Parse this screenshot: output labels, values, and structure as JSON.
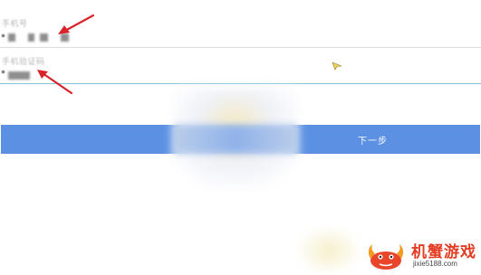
{
  "form": {
    "phone": {
      "label": "手机号",
      "value_masked": true
    },
    "code": {
      "label": "手机验证码",
      "value_masked": true
    }
  },
  "actions": {
    "next_label": "下一步"
  },
  "watermark": {
    "brand": "机蟹游戏",
    "url": "jixie5188.com"
  },
  "colors": {
    "button": "#5b90e2",
    "active_underline": "#7fc3dc",
    "arrow": "#d9232a",
    "watermark_red": "#e43b23"
  }
}
